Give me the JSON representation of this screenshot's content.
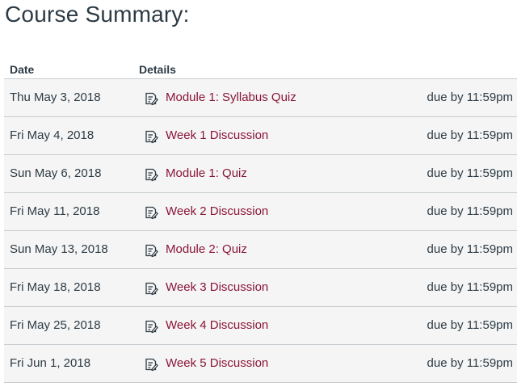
{
  "title": "Course Summary:",
  "table": {
    "headers": {
      "date": "Date",
      "details": "Details"
    },
    "rows": [
      {
        "date": "Thu May 3, 2018",
        "name": "Module 1: Syllabus Quiz",
        "due": "due by 11:59pm",
        "icon": "assignment-icon"
      },
      {
        "date": "Fri May 4, 2018",
        "name": "Week 1 Discussion",
        "due": "due by 11:59pm",
        "icon": "assignment-icon"
      },
      {
        "date": "Sun May 6, 2018",
        "name": "Module 1: Quiz",
        "due": "due by 11:59pm",
        "icon": "assignment-icon"
      },
      {
        "date": "Fri May 11, 2018",
        "name": "Week 2 Discussion",
        "due": "due by 11:59pm",
        "icon": "assignment-icon"
      },
      {
        "date": "Sun May 13, 2018",
        "name": "Module 2: Quiz",
        "due": "due by 11:59pm",
        "icon": "assignment-icon"
      },
      {
        "date": "Fri May 18, 2018",
        "name": "Week 3 Discussion",
        "due": "due by 11:59pm",
        "icon": "assignment-icon"
      },
      {
        "date": "Fri May 25, 2018",
        "name": "Week 4 Discussion",
        "due": "due by 11:59pm",
        "icon": "assignment-icon"
      },
      {
        "date": "Fri Jun 1, 2018",
        "name": "Week 5 Discussion",
        "due": "due by 11:59pm",
        "icon": "assignment-icon"
      }
    ]
  },
  "colors": {
    "link": "#8a1538",
    "text": "#2d3b45",
    "row_bg": "#f5f5f5",
    "border": "#c7cdd1"
  }
}
